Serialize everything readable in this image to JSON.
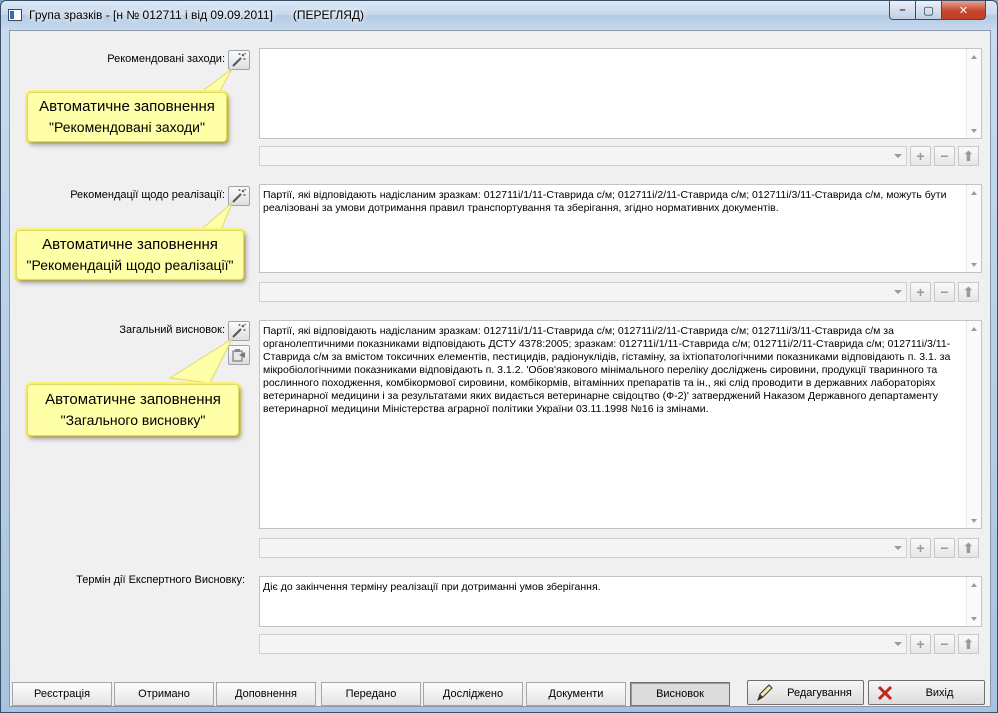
{
  "window": {
    "title": "Група зразків - [н № 012711 і від 09.09.2011]      (ПЕРЕГЛЯД)",
    "controls": {
      "minimize": "–",
      "maximize": "▢",
      "close": "✕"
    }
  },
  "sections": [
    {
      "label": "Рекомендовані заходи:",
      "text": ""
    },
    {
      "label": "Рекомендації щодо реалізації:",
      "text": "Партії, які відповідають надісланим зразкам: 012711і/1/11-Ставрида с/м; 012711і/2/11-Ставрида с/м; 012711і/3/11-Ставрида с/м, можуть бути реалізовані за умови дотримання правил транспортування та зберігання, згідно нормативних документів."
    },
    {
      "label": "Загальний висновок:",
      "text": "Партії, які відповідають надісланим зразкам: 012711і/1/11-Ставрида с/м; 012711і/2/11-Ставрида с/м; 012711і/3/11-Ставрида с/м за органолептичними показниками відповідають ДСТУ 4378:2005; зразкам: 012711і/1/11-Ставрида с/м; 012711і/2/11-Ставрида с/м; 012711і/3/11-Ставрида с/м за вмістом токсичних елементів,  пестицидів,  радіонуклідів,  гістаміну, за іхтіопатологічними показниками відповідають п. 3.1. за мікробіологічними показниками відповідають п. 3.1.2. 'Обов'язкового мінімального переліку досліджень сировини, продукції тваринного та рослинного походження, комбікормової сировини, комбікормів, вітамінних препаратів та ін., які слід проводити в державних лабораторіях ветеринарної медицини і за результатами яких видається ветеринарне свідоцтво (Ф-2)' затверджений Наказом Державного департаменту ветеринарної медицини Міністерства аграрної політики України 03.11.1998 №16 із змінами."
    },
    {
      "label": "Термін дії Експертного Висновку:",
      "text": "Діє до закінчення терміну реалізації при дотриманні умов зберігання."
    }
  ],
  "callouts": [
    {
      "line1": "Автоматичне заповнення",
      "line2": "\"Рекомендовані заходи\""
    },
    {
      "line1": "Автоматичне заповнення",
      "line2": "\"Рекомендацій щодо реалізації\""
    },
    {
      "line1": "Автоматичне заповнення",
      "line2": "\"Загального висновку\""
    }
  ],
  "row_buttons": {
    "add": "+",
    "remove": "−",
    "up": "⬆"
  },
  "tabs": [
    {
      "label": "Реєстрація",
      "active": false
    },
    {
      "label": "Отримано",
      "active": false
    },
    {
      "label": "Доповнення",
      "active": false
    },
    {
      "label": "Передано",
      "active": false
    },
    {
      "label": "Досліджено",
      "active": false
    },
    {
      "label": "Документи",
      "active": false
    },
    {
      "label": "Висновок",
      "active": true
    }
  ],
  "actions": {
    "edit_label": "Редагування",
    "exit_label": "Вихід"
  },
  "icons": {
    "autofill": "magic-wand-icon",
    "paste": "paste-icon",
    "edit": "pencil-icon",
    "exit": "red-x-icon"
  },
  "colors": {
    "callout_bg": "#ffffa8",
    "callout_border": "#e0d86a",
    "exit_icon": "#c0281c"
  }
}
